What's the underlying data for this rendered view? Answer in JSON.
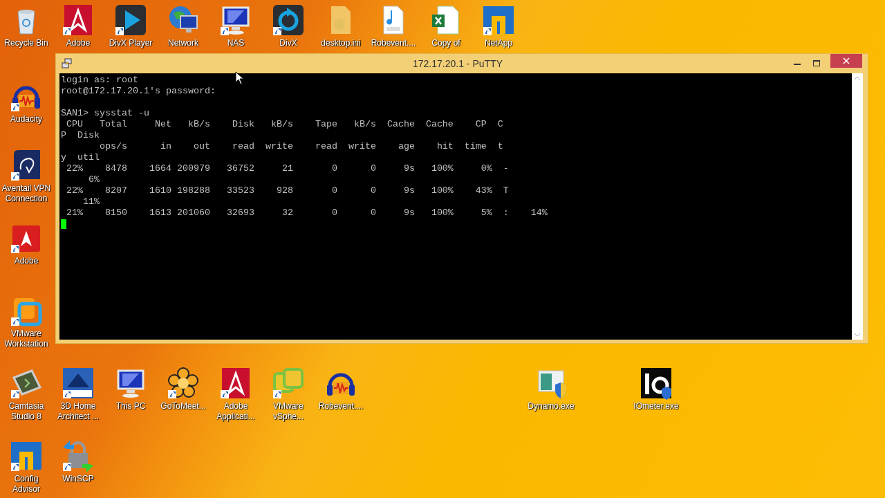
{
  "desktop_icons": [
    {
      "label": "Recycle Bin",
      "shortcut": false
    },
    {
      "label": "Adobe",
      "shortcut": true
    },
    {
      "label": "DivX Player",
      "shortcut": true
    },
    {
      "label": "Network",
      "shortcut": false
    },
    {
      "label": "NAS",
      "shortcut": true
    },
    {
      "label": "DivX",
      "shortcut": true
    },
    {
      "label": "desktop.ini",
      "shortcut": false
    },
    {
      "label": "Robevent....",
      "shortcut": false
    },
    {
      "label": "Copy of",
      "shortcut": false
    },
    {
      "label": "NetApp",
      "shortcut": true
    },
    {
      "label": "Audacity",
      "shortcut": true
    },
    {
      "label": "Aventail VPN Connection",
      "shortcut": true
    },
    {
      "label": "Adobe",
      "shortcut": true
    },
    {
      "label": "VMware Workstation",
      "shortcut": true
    },
    {
      "label": "Camtasia Studio 8",
      "shortcut": true
    },
    {
      "label": "3D Home Architect ...",
      "shortcut": true
    },
    {
      "label": "This PC",
      "shortcut": false
    },
    {
      "label": "GoToMeet...",
      "shortcut": true
    },
    {
      "label": "Adobe Applicati...",
      "shortcut": true
    },
    {
      "label": "VMware vSphe...",
      "shortcut": true
    },
    {
      "label": "Robevent....",
      "shortcut": false
    },
    {
      "label": "Dynamo.exe",
      "shortcut": false
    },
    {
      "label": "IOmeter.exe",
      "shortcut": false
    },
    {
      "label": "Config Advisor",
      "shortcut": true
    },
    {
      "label": "WinSCP",
      "shortcut": true
    }
  ],
  "window": {
    "title": "172.17.20.1 - PuTTY",
    "login_lines": [
      "login as: root",
      "root@172.17.20.1's password:"
    ],
    "output_lines": [
      "SAN1> sysstat -u",
      " CPU   Total     Net   kB/s    Disk   kB/s    Tape   kB/s  Cache  Cache    CP  C",
      "P  Disk",
      "       ops/s      in    out    read  write    read  write    age    hit  time  t",
      "y  util",
      " 22%    8478    1664 200979   36752     21       0      0     9s   100%     0%  -",
      "     6%",
      " 22%    8207    1610 198288   33523    928       0      0     9s   100%    43%  T",
      "    11%",
      " 21%    8150    1613 201060   32693     32       0      0     9s   100%     5%  :    14%"
    ]
  }
}
